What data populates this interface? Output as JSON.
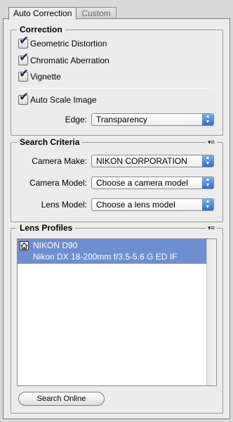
{
  "tabs": {
    "auto_correction": "Auto Correction",
    "custom": "Custom"
  },
  "correction": {
    "legend": "Correction",
    "geometric_distortion": "Geometric Distortion",
    "chromatic_aberration": "Chromatic Aberration",
    "vignette": "Vignette",
    "auto_scale_image": "Auto Scale Image",
    "edge_label": "Edge:",
    "edge_value": "Transparency"
  },
  "search_criteria": {
    "legend": "Search Criteria",
    "camera_make_label": "Camera Make:",
    "camera_make_value": "NIKON CORPORATION",
    "camera_model_label": "Camera Model:",
    "camera_model_value": "Choose a camera model",
    "lens_model_label": "Lens Model:",
    "lens_model_value": "Choose a lens model"
  },
  "lens_profiles": {
    "legend": "Lens Profiles",
    "items": [
      {
        "camera": "NIKON D90",
        "lens": "Nikon DX 18-200mm f/3.5-5.6 G ED IF"
      }
    ],
    "search_online_label": "Search Online"
  },
  "icons": {
    "checkmark": "✔",
    "panel_menu": "▾≡",
    "select_arrows": "▴▾",
    "profile_icon": "home-icon"
  },
  "checked": {
    "geometric_distortion": true,
    "chromatic_aberration": true,
    "vignette": true,
    "auto_scale_image": true
  },
  "colors": {
    "selection": "#6d8fcf",
    "select_arrow": "#2f6ec9"
  }
}
